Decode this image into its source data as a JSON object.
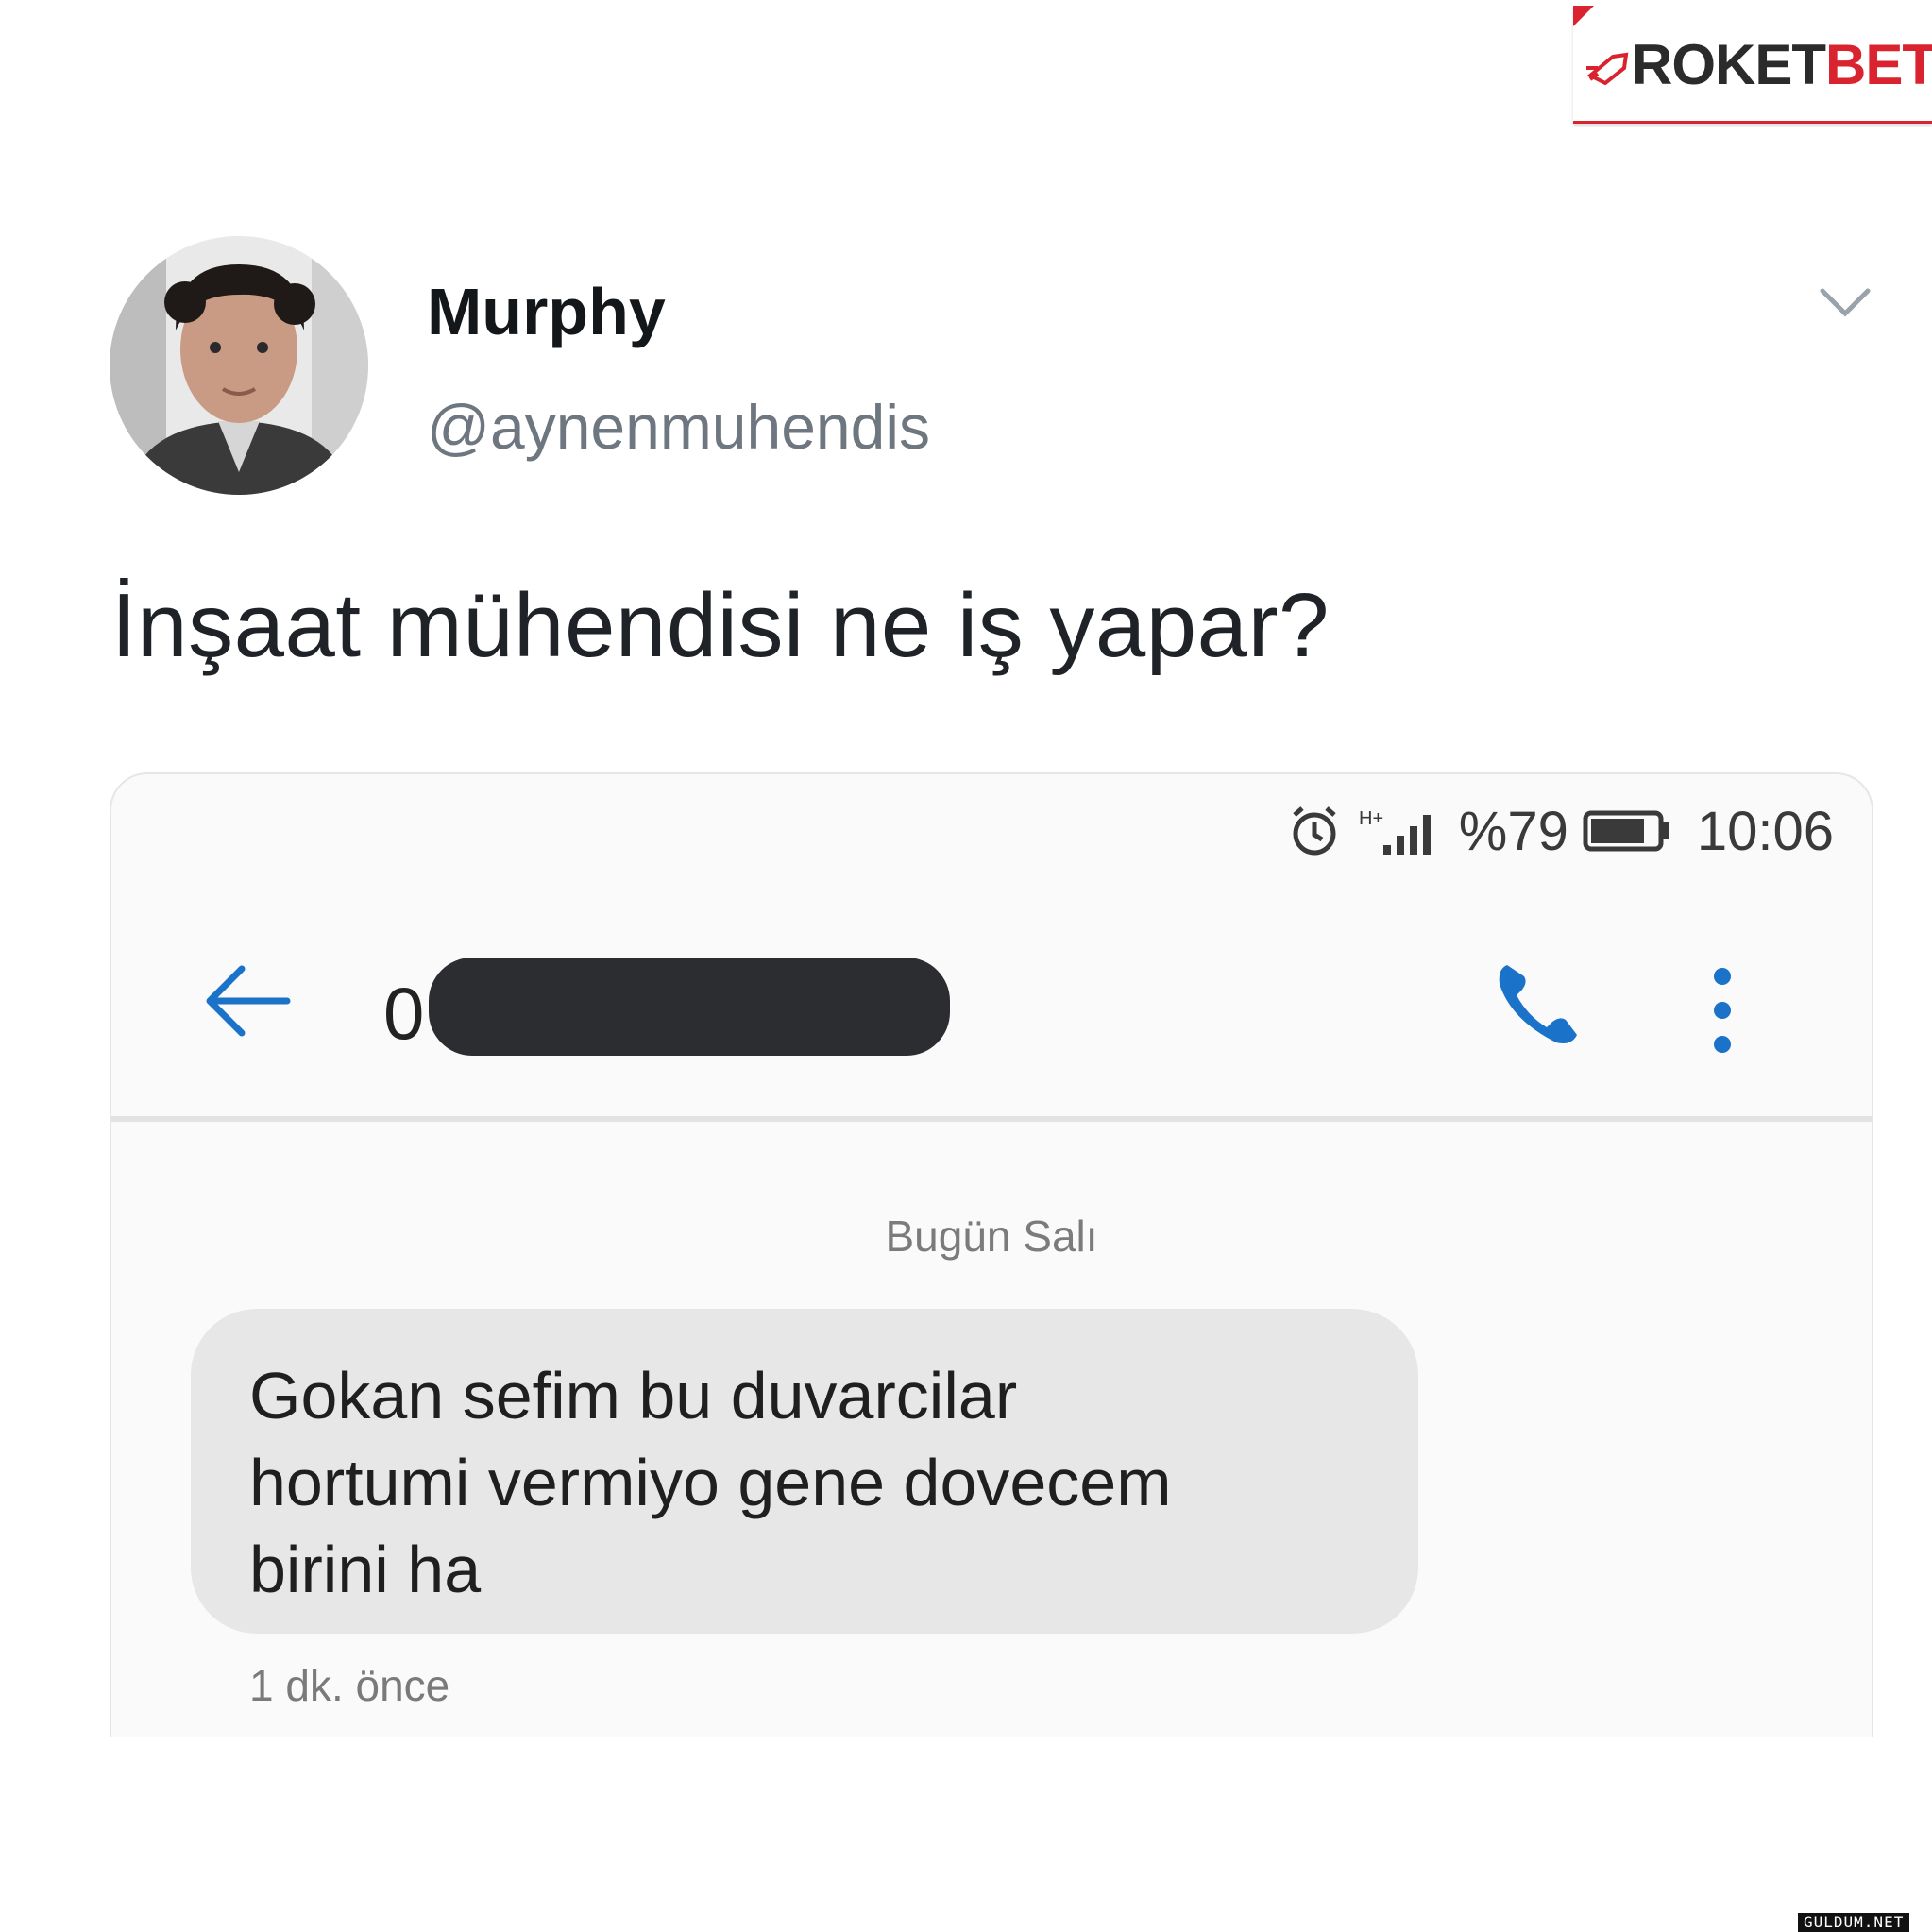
{
  "logo": {
    "text_part1": "ROKET",
    "text_part2": "BET",
    "accent_color": "#d9232e",
    "icon": "rocket-icon"
  },
  "tweet": {
    "author_name": "Murphy",
    "author_handle": "@aynenmuhendis",
    "text": "İnşaat mühendisi ne iş yapar?",
    "menu_icon": "chevron-down-icon"
  },
  "sms_screenshot": {
    "status_bar": {
      "battery_percent": "%79",
      "time": "10:06",
      "icons": [
        "alarm-icon",
        "signal-icon",
        "battery-icon"
      ]
    },
    "app_bar": {
      "contact_visible_prefix": "0",
      "back_icon": "arrow-left-icon",
      "call_icon": "phone-icon",
      "more_icon": "more-vertical-icon",
      "accent_color": "#1a73c8"
    },
    "date_separator": "Bugün Salı",
    "message": {
      "lines": [
        "Gokan sefim bu duvarcilar",
        "hortumi vermiyo gene dovecem",
        "birini ha"
      ],
      "time": "1 dk. önce"
    }
  },
  "watermark": "GULDUM.NET"
}
